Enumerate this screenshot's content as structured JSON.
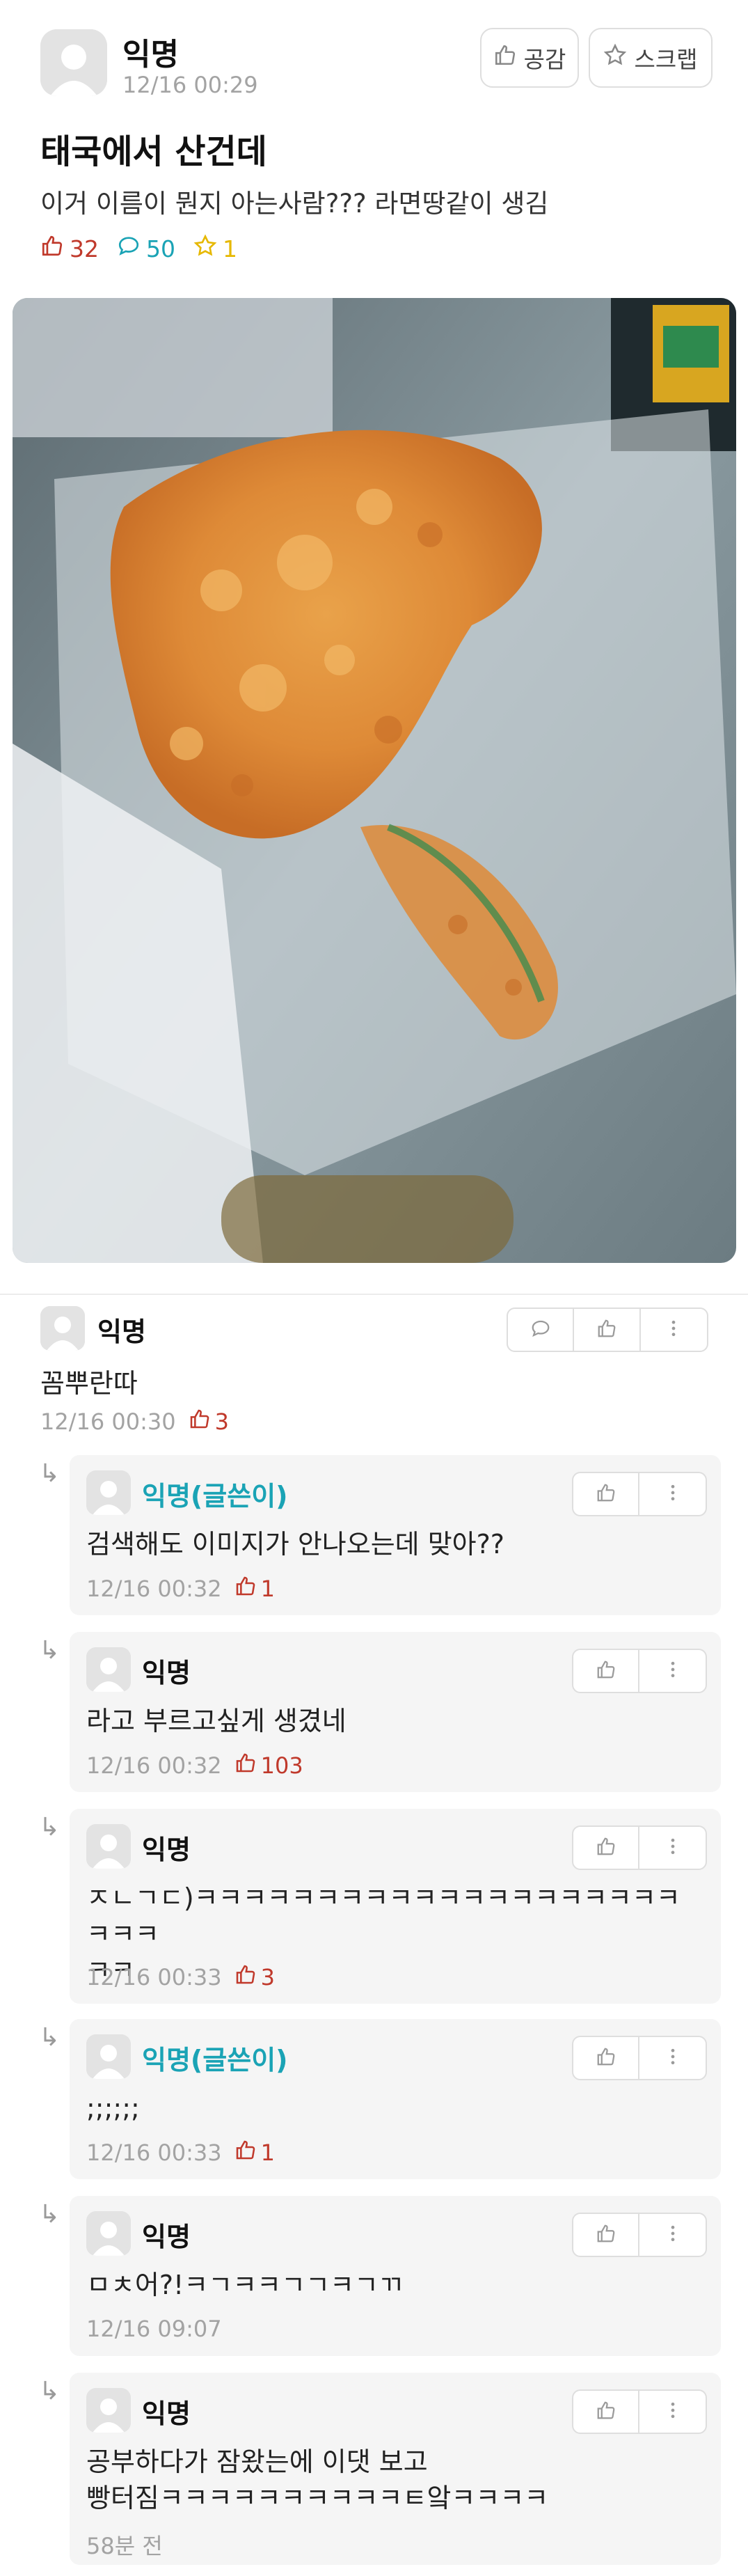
{
  "post": {
    "author": "익명",
    "time": "12/16 00:29",
    "buttons": {
      "like": "공감",
      "scrap": "스크랩"
    },
    "title": "태국에서 산건데",
    "body": "이거 이름이 뭔지 아는사람??? 라면땅같이 생김",
    "stats": {
      "likes": "32",
      "comments": "50",
      "scraps": "1"
    },
    "colors": {
      "like": "#c0392b",
      "comment": "#1aa3b5",
      "scrap": "#e6b800"
    }
  },
  "comment": {
    "author": "익명",
    "text": "꼼뿌란따",
    "time": "12/16 00:30",
    "likes": "3"
  },
  "replies": [
    {
      "author": "익명(글쓴이)",
      "is_op": true,
      "text": "검색해도 이미지가 안나오는데 맞아??",
      "time": "12/16 00:32",
      "likes": "1"
    },
    {
      "author": "익명",
      "is_op": false,
      "text": "라고 부르고싶게 생겼네",
      "time": "12/16 00:32",
      "likes": "103"
    },
    {
      "author": "익명",
      "is_op": false,
      "text": "ㅈㄴㄱㄷ)ㅋㅋㅋㅋㅋㅋㅋㅋㅋㅋㅋㅋㅋㅋㅋㅋㅋㅋㅋㅋㅋㅋㅋ\nㅋㅋ",
      "time": "12/16 00:33",
      "likes": "3"
    },
    {
      "author": "익명(글쓴이)",
      "is_op": true,
      "text": ";;;;;;",
      "time": "12/16 00:33",
      "likes": "1"
    },
    {
      "author": "익명",
      "is_op": false,
      "text": "ㅁㅊ어?!ㅋㄱㅋㅋㄱㄱㅋㄱㄲ",
      "time": "12/16 09:07",
      "likes": ""
    },
    {
      "author": "익명",
      "is_op": false,
      "text": "공부하다가 잠왔는에 이댓 보고\n빵터짐ㅋㅋㅋㅋㅋㅋㅋㅋㅋㅋㅌ앜ㅋㅋㅋㅋ",
      "time": "58분 전",
      "likes": ""
    }
  ],
  "reply_arrow": "↳",
  "icons": [
    "thumbs-up-icon",
    "speech-bubble-icon",
    "star-icon",
    "more-vertical-icon",
    "avatar-placeholder-icon"
  ]
}
